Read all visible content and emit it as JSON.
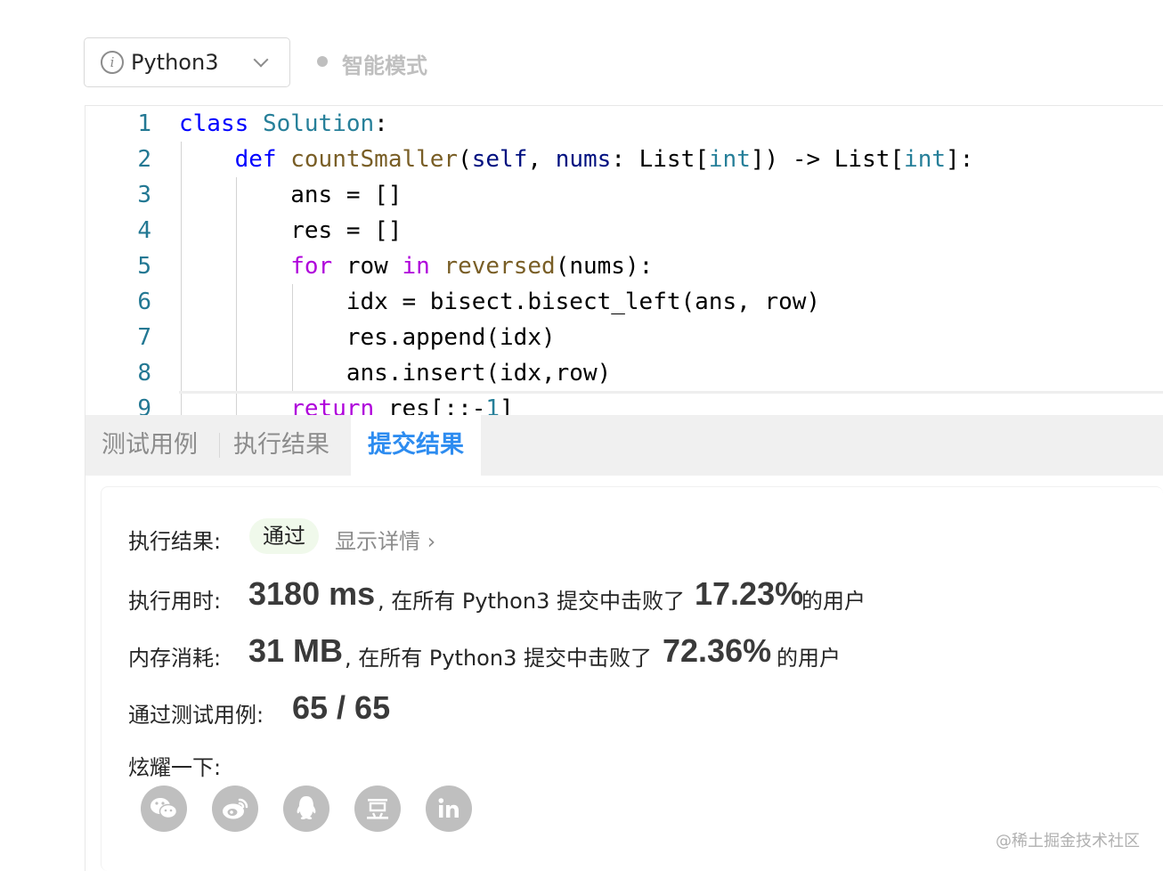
{
  "toolbar": {
    "language": "Python3",
    "mode_label": "智能模式"
  },
  "editor": {
    "lines": [
      {
        "num": "1",
        "tokens": [
          {
            "t": "class",
            "c": "kw"
          },
          {
            "t": " "
          },
          {
            "t": "Solution",
            "c": "cls"
          },
          {
            "t": ":"
          }
        ]
      },
      {
        "num": "2",
        "tokens": [
          {
            "t": "    "
          },
          {
            "t": "def",
            "c": "kw"
          },
          {
            "t": " "
          },
          {
            "t": "countSmaller",
            "c": "fn"
          },
          {
            "t": "("
          },
          {
            "t": "self",
            "c": "par"
          },
          {
            "t": ", "
          },
          {
            "t": "nums",
            "c": "par"
          },
          {
            "t": ": List["
          },
          {
            "t": "int",
            "c": "cls"
          },
          {
            "t": "]) -> List["
          },
          {
            "t": "int",
            "c": "cls"
          },
          {
            "t": "]:"
          }
        ]
      },
      {
        "num": "3",
        "tokens": [
          {
            "t": "        ans = []"
          }
        ]
      },
      {
        "num": "4",
        "tokens": [
          {
            "t": "        res = []"
          }
        ]
      },
      {
        "num": "5",
        "tokens": [
          {
            "t": "        "
          },
          {
            "t": "for",
            "c": "kw2"
          },
          {
            "t": " row "
          },
          {
            "t": "in",
            "c": "kw2"
          },
          {
            "t": " "
          },
          {
            "t": "reversed",
            "c": "fn"
          },
          {
            "t": "(nums):"
          }
        ]
      },
      {
        "num": "6",
        "tokens": [
          {
            "t": "            idx = bisect.bisect_left(ans, row)"
          }
        ]
      },
      {
        "num": "7",
        "tokens": [
          {
            "t": "            res.append(idx)"
          }
        ]
      },
      {
        "num": "8",
        "tokens": [
          {
            "t": "            ans.insert(idx,row)"
          }
        ]
      },
      {
        "num": "9",
        "tokens": [
          {
            "t": "        "
          },
          {
            "t": "return",
            "c": "kw2"
          },
          {
            "t": " res[::-"
          },
          {
            "t": "1",
            "c": "cls"
          },
          {
            "t": "]"
          }
        ]
      }
    ]
  },
  "tabs": [
    {
      "label": "测试用例"
    },
    {
      "label": "执行结果"
    },
    {
      "label": "提交结果"
    }
  ],
  "result": {
    "status_label": "执行结果:",
    "status_value": "通过",
    "details_link": "显示详情 ›",
    "runtime_label": "执行用时:",
    "runtime_value": "3180 ms",
    "runtime_text": ", 在所有 Python3 提交中击败了",
    "runtime_percent": "17.23%",
    "runtime_suffix": "的用户",
    "memory_label": "内存消耗:",
    "memory_value": "31 MB",
    "memory_text": ", 在所有 Python3 提交中击败了",
    "memory_percent": "72.36%",
    "memory_suffix": "的用户",
    "cases_label": "通过测试用例:",
    "cases_value": "65 / 65",
    "share_label": "炫耀一下:"
  },
  "share_icons": [
    "wechat-icon",
    "weibo-icon",
    "qq-icon",
    "douban-icon",
    "linkedin-icon"
  ],
  "watermark": "@稀土掘金技术社区"
}
